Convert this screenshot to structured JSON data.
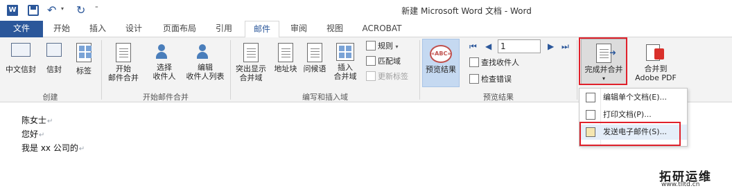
{
  "titlebar": {
    "app_icon": "W",
    "title": "新建 Microsoft Word 文档 - Word"
  },
  "tabs": [
    {
      "label": "文件"
    },
    {
      "label": "开始"
    },
    {
      "label": "插入"
    },
    {
      "label": "设计"
    },
    {
      "label": "页面布局"
    },
    {
      "label": "引用"
    },
    {
      "label": "邮件"
    },
    {
      "label": "审阅"
    },
    {
      "label": "视图"
    },
    {
      "label": "ACROBAT"
    }
  ],
  "active_tab": "邮件",
  "ribbon": {
    "create": {
      "group_label": "创建",
      "buttons": [
        "中文信封",
        "信封",
        "标签"
      ]
    },
    "start_merge": {
      "group_label": "开始邮件合并",
      "start_line1": "开始",
      "start_line2": "邮件合并",
      "select_line1": "选择",
      "select_line2": "收件人",
      "edit_line1": "编辑",
      "edit_line2": "收件人列表"
    },
    "write_insert": {
      "group_label": "编写和插入域",
      "highlight_line1": "突出显示",
      "highlight_line2": "合并域",
      "address_block": "地址块",
      "greeting": "问候语",
      "insert_line1": "插入",
      "insert_line2": "合并域",
      "rules": "规则",
      "match_fields": "匹配域",
      "update_labels": "更新标签"
    },
    "preview": {
      "group_label": "预览结果",
      "preview_button": "预览结果",
      "preview_icon_text": "«ABC»",
      "record_value": "1",
      "find_recipient": "查找收件人",
      "check_errors": "检查错误"
    },
    "finish": {
      "finish_label": "完成并合并",
      "merge_pdf_line1": "合并到",
      "merge_pdf_line2": "Adobe PDF"
    }
  },
  "finish_menu": {
    "items": [
      {
        "label": "编辑单个文档(E)..."
      },
      {
        "label": "打印文档(P)..."
      },
      {
        "label": "发送电子邮件(S)..."
      }
    ]
  },
  "document": {
    "lines": [
      "陈女士",
      "您好",
      "我是 xx 公司的"
    ],
    "para_mark": "↵"
  },
  "watermark": {
    "title": "拓研运维",
    "url": "www.tlltd.cn"
  },
  "colors": {
    "brand": "#2b579a",
    "highlight_outline": "#e0202a"
  }
}
